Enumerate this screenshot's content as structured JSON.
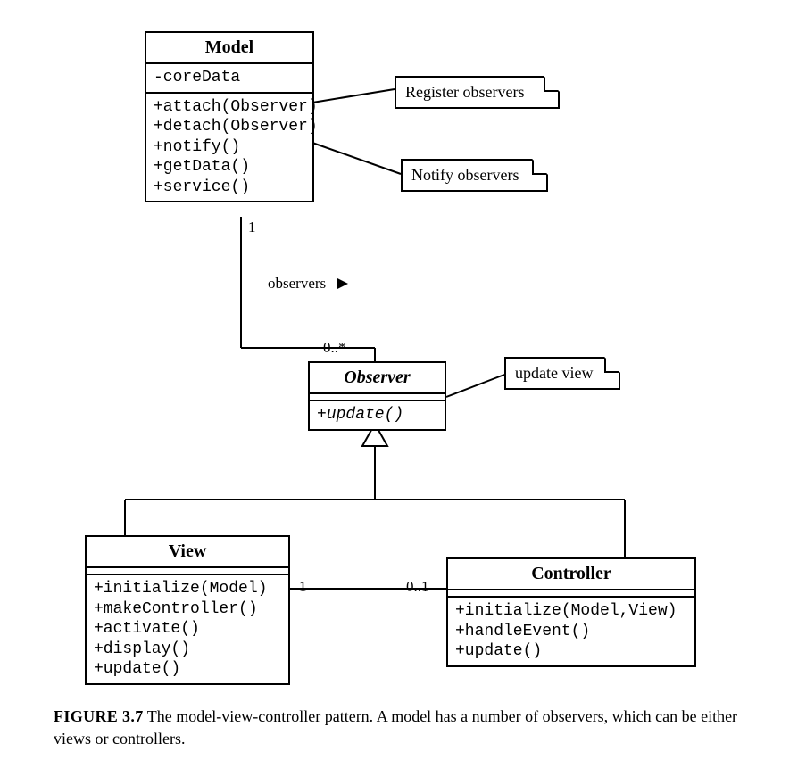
{
  "classes": {
    "model": {
      "name": "Model",
      "attrs": [
        "-coreData"
      ],
      "ops": [
        "+attach(Observer)",
        "+detach(Observer)",
        "+notify()",
        "+getData()",
        "+service()"
      ]
    },
    "observer": {
      "name": "Observer",
      "ops": [
        "+update()"
      ]
    },
    "view": {
      "name": "View",
      "ops": [
        "+initialize(Model)",
        "+makeController()",
        "+activate()",
        "+display()",
        "+update()"
      ]
    },
    "controller": {
      "name": "Controller",
      "ops": [
        "+initialize(Model,View)",
        "+handleEvent()",
        "+update()"
      ]
    }
  },
  "notes": {
    "register": "Register observers",
    "notify": "Notify observers",
    "updateview": "update view"
  },
  "assoc": {
    "model_mult": "1",
    "role": "observers",
    "observer_mult": "0..*",
    "view_mult": "1",
    "controller_mult": "0..1"
  },
  "caption": {
    "label": "FIGURE 3.7",
    "text": " The model-view-controller pattern. A model has a number of observers, which can be either views or controllers."
  }
}
